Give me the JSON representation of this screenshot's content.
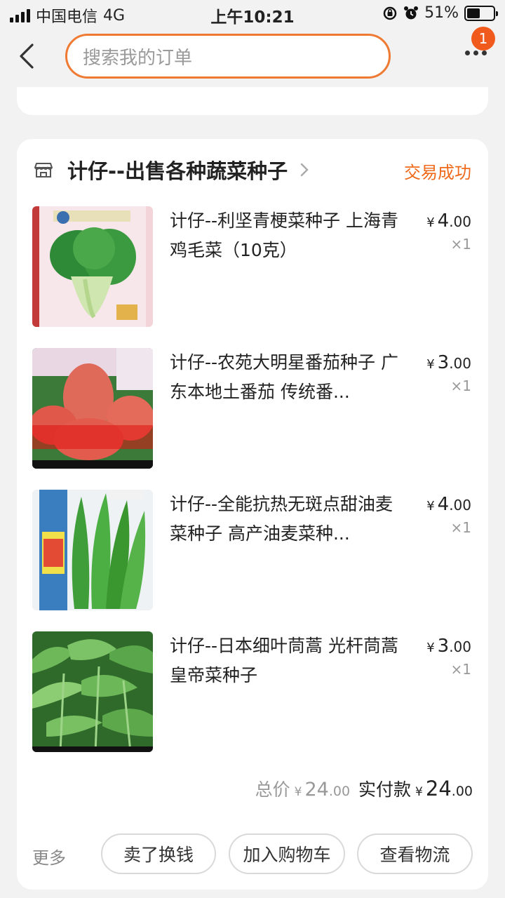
{
  "status_bar": {
    "carrier": "中国电信",
    "network": "4G",
    "time": "上午10:21",
    "battery": "51%",
    "battery_level": 0.51
  },
  "header": {
    "search_placeholder": "搜索我的订单",
    "notification_count": "1",
    "icons": [
      "back-arrow-icon",
      "more-dots-icon"
    ]
  },
  "order": {
    "shop_name": "计仔--出售各种蔬菜种子",
    "status": "交易成功",
    "items": [
      {
        "title": "计仔--利坚青梗菜种子 上海青 鸡毛菜（10克）",
        "currency": "¥",
        "price_int": "4",
        "price_dec": ".00",
        "qty": "×1"
      },
      {
        "title": "计仔--农苑大明星番茄种子 广东本地土番茄 传统番...",
        "currency": "¥",
        "price_int": "3",
        "price_dec": ".00",
        "qty": "×1"
      },
      {
        "title": "计仔--全能抗热无斑点甜油麦菜种子 高产油麦菜种...",
        "currency": "¥",
        "price_int": "4",
        "price_dec": ".00",
        "qty": "×1"
      },
      {
        "title": "计仔--日本细叶茼蒿 光杆茼蒿 皇帝菜种子",
        "currency": "¥",
        "price_int": "3",
        "price_dec": ".00",
        "qty": "×1"
      }
    ],
    "total": {
      "label": "总价",
      "currency": "¥",
      "int": "24",
      "dec": ".00",
      "paid_label": "实付款",
      "paid_currency": "¥",
      "paid_int": "24",
      "paid_dec": ".00"
    },
    "more_label": "更多",
    "actions": [
      "卖了换钱",
      "加入购物车",
      "查看物流"
    ]
  },
  "colors": {
    "accent": "#ee7a33",
    "status": "#f06a1c",
    "badge": "#f05a1c"
  }
}
